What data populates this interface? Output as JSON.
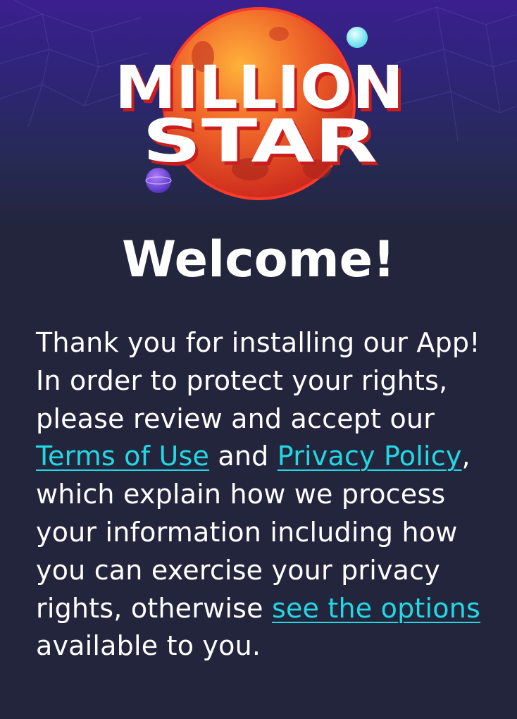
{
  "logo": {
    "line1": "MILLION",
    "line2": "STAR"
  },
  "welcome": {
    "title": "Welcome!",
    "text_before_terms": "Thank you for installing our App! In order to protect your rights, please review and accept our ",
    "terms_link": "Terms of Use",
    "text_between_links": " and ",
    "privacy_link": "Privacy Policy",
    "text_after_privacy": ", which explain how we process your information including how you can exercise your privacy rights, otherwise ",
    "options_link": "see the options",
    "text_end": " available to you."
  },
  "colors": {
    "background": "#23253d",
    "link": "#21d8e3",
    "text": "#ffffff",
    "planet": "#e8482a"
  }
}
